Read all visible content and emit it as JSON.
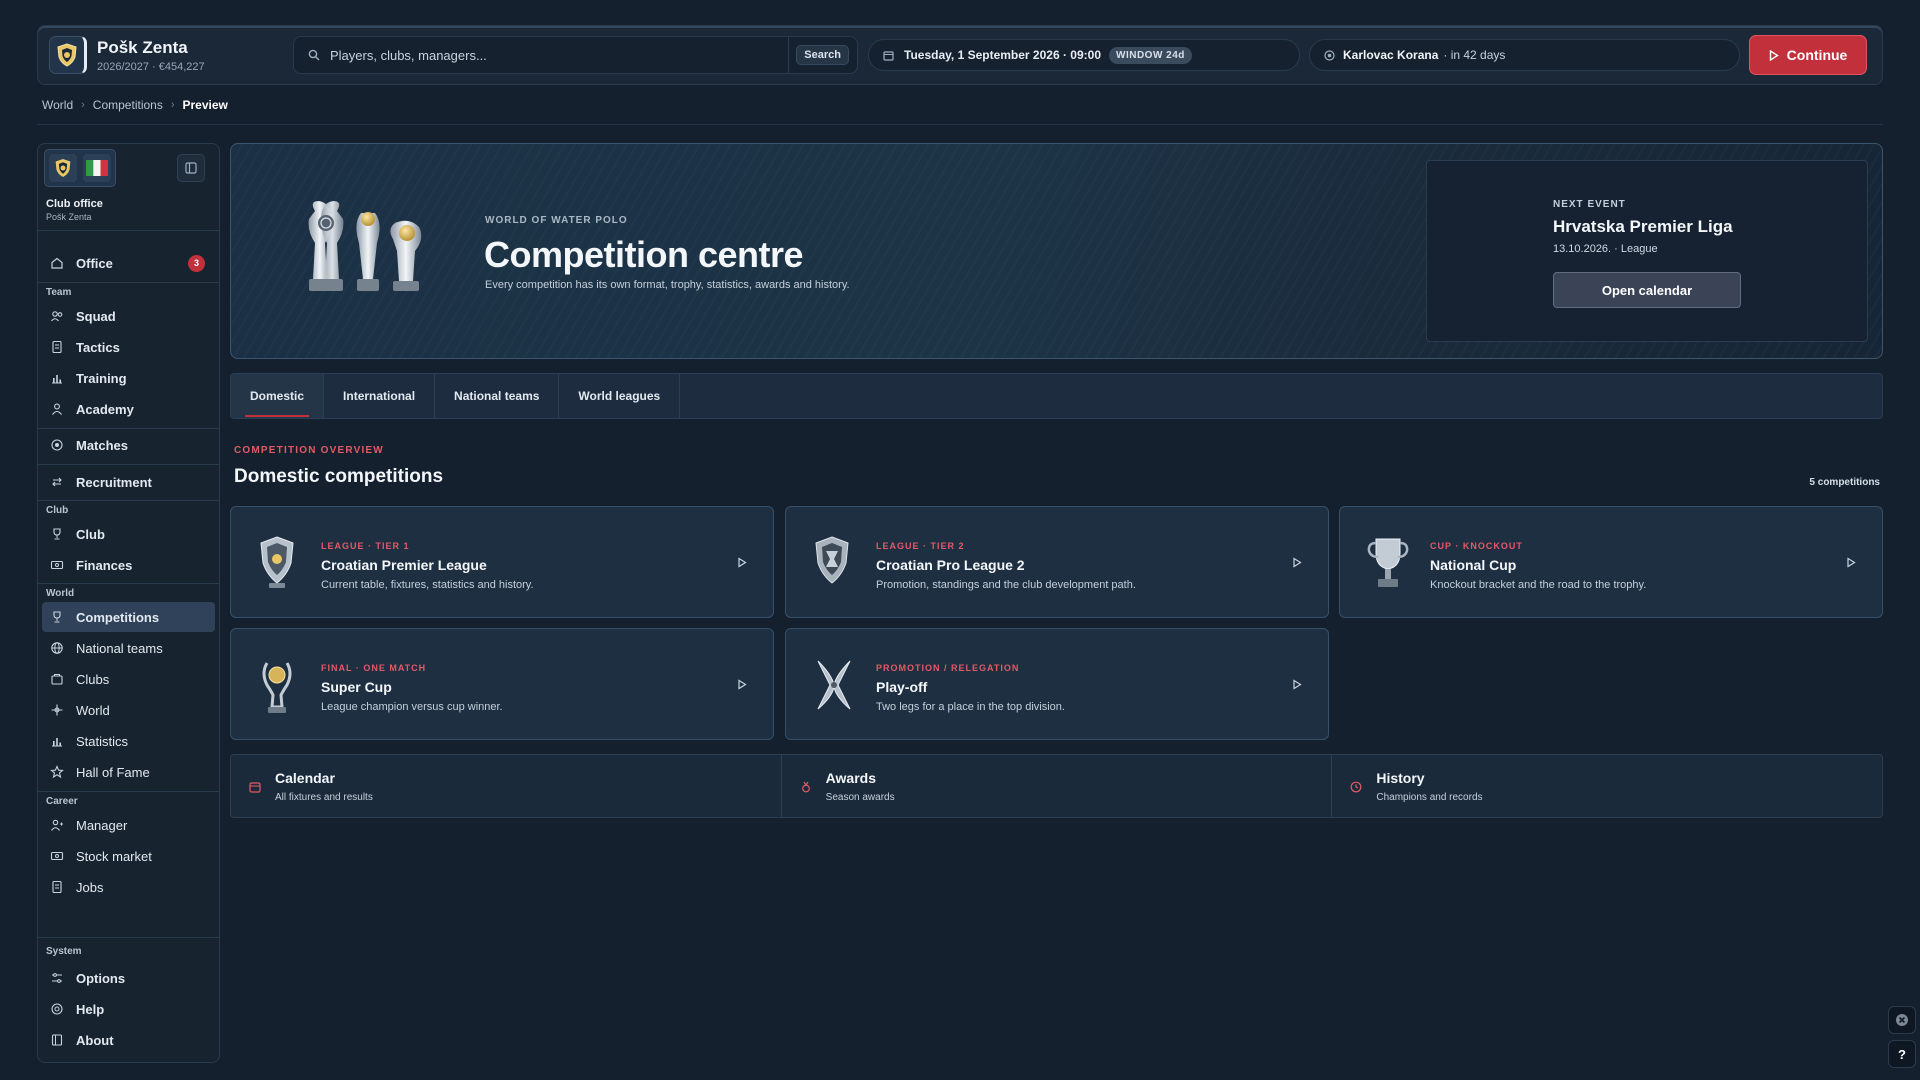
{
  "colors": {
    "accent": "#c2303c",
    "kicker": "#e05b66",
    "background": "#14202e"
  },
  "topbar": {
    "club_name": "Pošk Zenta",
    "club_sub": "2026/2027 · €454,227",
    "search_placeholder": "Players, clubs, managers...",
    "search_button": "Search",
    "date": "Tuesday, 1 September 2026 · 09:00",
    "window_badge": "WINDOW 24d",
    "next_opponent": "Karlovac Korana",
    "next_when": "· in 42 days",
    "continue_label": "Continue"
  },
  "breadcrumb": [
    "World",
    "Competitions",
    "Preview"
  ],
  "sidebar": {
    "office_title": "Club office",
    "office_sub": "Pošk Zenta",
    "office_label": "Office",
    "office_badge": "3",
    "sections": {
      "team": "Team",
      "club": "Club",
      "world": "World",
      "career": "Career",
      "system": "System"
    },
    "items": {
      "squad": "Squad",
      "tactics": "Tactics",
      "training": "Training",
      "academy": "Academy",
      "matches": "Matches",
      "recruitment": "Recruitment",
      "club": "Club",
      "finances": "Finances",
      "competitions": "Competitions",
      "national_teams": "National teams",
      "clubs": "Clubs",
      "world": "World",
      "statistics": "Statistics",
      "hall_of_fame": "Hall of Fame",
      "manager": "Manager",
      "stock_market": "Stock market",
      "jobs": "Jobs",
      "options": "Options",
      "help": "Help",
      "about": "About"
    }
  },
  "hero": {
    "kicker": "WORLD OF WATER POLO",
    "title": "Competition centre",
    "description": "Every competition has its own format, trophy, statistics, awards and history.",
    "next_event": {
      "kicker": "NEXT EVENT",
      "title": "Hrvatska Premier Liga",
      "meta": "13.10.2026. · League",
      "button": "Open calendar"
    }
  },
  "tabs": [
    "Domestic",
    "International",
    "National teams",
    "World leagues"
  ],
  "overview": {
    "kicker": "COMPETITION OVERVIEW",
    "title": "Domestic competitions",
    "count": "5 competitions"
  },
  "cards": [
    {
      "kicker": "LEAGUE · TIER 1",
      "name": "Croatian Premier League",
      "desc": "Current table, fixtures, statistics and history.",
      "icon": "shield-trophy-icon"
    },
    {
      "kicker": "LEAGUE · TIER 2",
      "name": "Croatian Pro League 2",
      "desc": "Promotion, standings and the club development path.",
      "icon": "shield-trophy-icon"
    },
    {
      "kicker": "CUP · KNOCKOUT",
      "name": "National Cup",
      "desc": "Knockout bracket and the road to the trophy.",
      "icon": "cup-trophy-icon"
    },
    {
      "kicker": "FINAL · ONE MATCH",
      "name": "Super Cup",
      "desc": "League champion versus cup winner.",
      "icon": "ball-trophy-icon"
    },
    {
      "kicker": "PROMOTION / RELEGATION",
      "name": "Play-off",
      "desc": "Two legs for a place in the top division.",
      "icon": "twisted-trophy-icon"
    }
  ],
  "strip": [
    {
      "title": "Calendar",
      "sub": "All fixtures and results",
      "icon": "calendar-icon"
    },
    {
      "title": "Awards",
      "sub": "Season awards",
      "icon": "medal-icon"
    },
    {
      "title": "History",
      "sub": "Champions and records",
      "icon": "clock-icon"
    }
  ],
  "corner": {
    "help_label": "?"
  }
}
